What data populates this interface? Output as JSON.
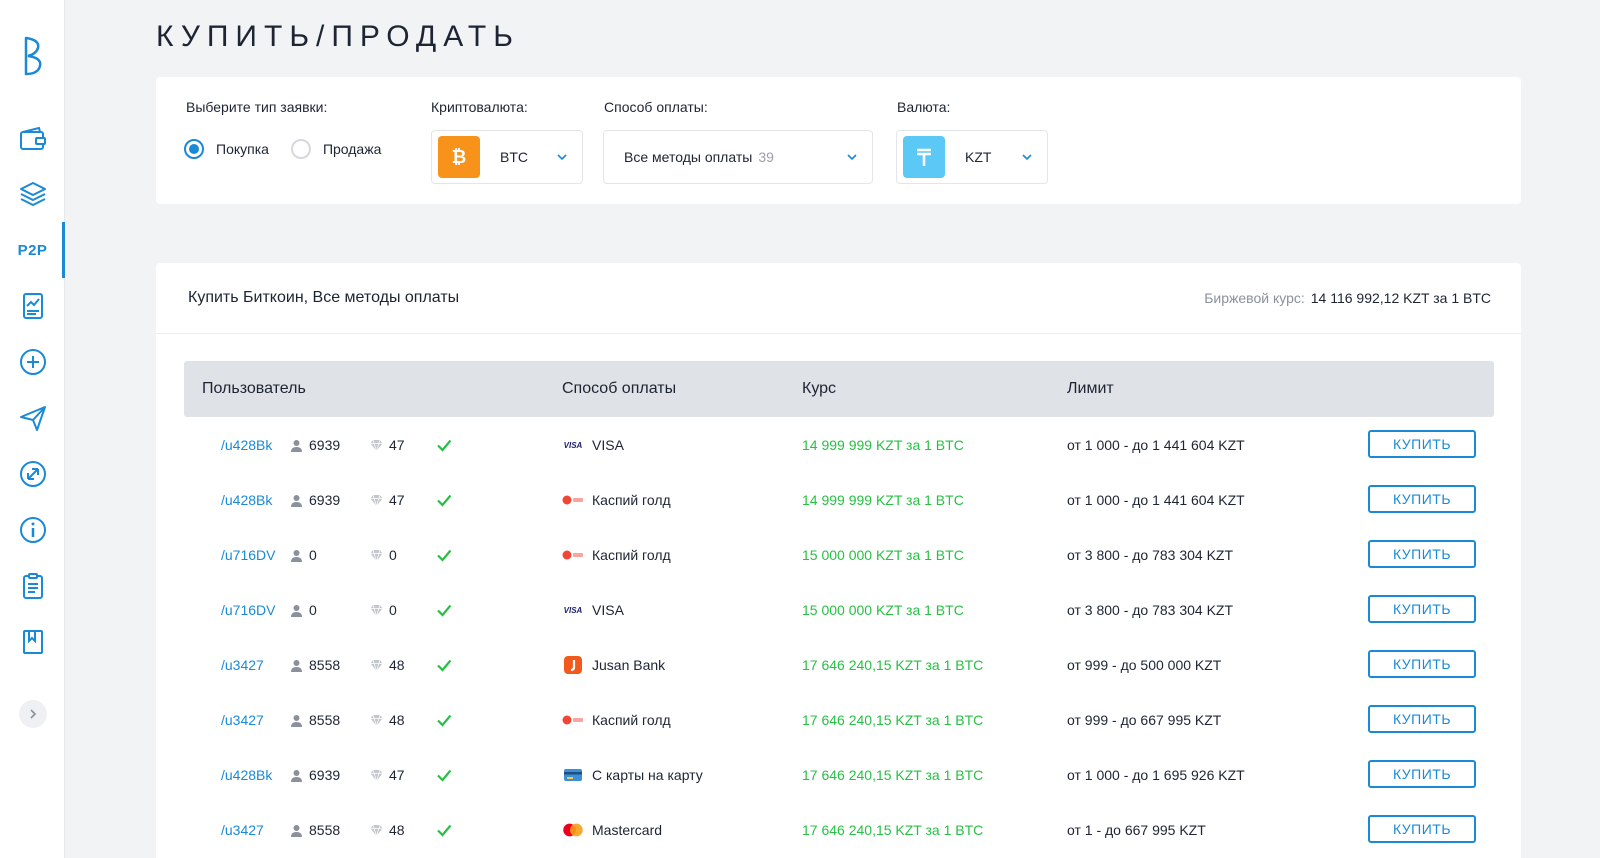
{
  "page": {
    "title": "КУПИТЬ/ПРОДАТЬ"
  },
  "sidebar": {
    "p2p_label": "P2P"
  },
  "filters": {
    "order_type_label": "Выберите тип заявки:",
    "buy_label": "Покупка",
    "sell_label": "Продажа",
    "selected_type": "buy",
    "crypto_label": "Криптовалюта:",
    "crypto_value": "BTC",
    "payment_label": "Способ оплаты:",
    "payment_value": "Все методы оплаты",
    "payment_count": "39",
    "currency_label": "Валюта:",
    "currency_value": "KZT"
  },
  "offers": {
    "title": "Купить Биткоин, Все методы оплаты",
    "rate_label": "Биржевой курс:",
    "rate_value": "14 116 992,12 KZT за 1 BTC",
    "columns": {
      "user": "Пользователь",
      "payment": "Способ оплаты",
      "rate": "Курс",
      "limit": "Лимит"
    },
    "buy_label": "КУПИТЬ",
    "rows": [
      {
        "user": "/u428Bk",
        "deals": "6939",
        "rating": "47",
        "method": "VISA",
        "method_icon": "visa-icon",
        "rate": "14 999 999 KZT за 1 BTC",
        "limit": "от 1 000 - до 1 441 604 KZT"
      },
      {
        "user": "/u428Bk",
        "deals": "6939",
        "rating": "47",
        "method": "Каспий голд",
        "method_icon": "kaspi-icon",
        "rate": "14 999 999 KZT за 1 BTC",
        "limit": "от 1 000 - до 1 441 604 KZT"
      },
      {
        "user": "/u716DV",
        "deals": "0",
        "rating": "0",
        "method": "Каспий голд",
        "method_icon": "kaspi-icon",
        "rate": "15 000 000 KZT за 1 BTC",
        "limit": "от 3 800 - до 783 304 KZT"
      },
      {
        "user": "/u716DV",
        "deals": "0",
        "rating": "0",
        "method": "VISA",
        "method_icon": "visa-icon",
        "rate": "15 000 000 KZT за 1 BTC",
        "limit": "от 3 800 - до 783 304 KZT"
      },
      {
        "user": "/u3427",
        "deals": "8558",
        "rating": "48",
        "method": "Jusan Bank",
        "method_icon": "jusan-icon",
        "rate": "17 646 240,15 KZT за 1 BTC",
        "limit": "от 999 - до 500 000 KZT"
      },
      {
        "user": "/u3427",
        "deals": "8558",
        "rating": "48",
        "method": "Каспий голд",
        "method_icon": "kaspi-icon",
        "rate": "17 646 240,15 KZT за 1 BTC",
        "limit": "от 999 - до 667 995 KZT"
      },
      {
        "user": "/u428Bk",
        "deals": "6939",
        "rating": "47",
        "method": "С карты на карту",
        "method_icon": "card-icon",
        "rate": "17 646 240,15 KZT за 1 BTC",
        "limit": "от 1 000 - до 1 695 926 KZT"
      },
      {
        "user": "/u3427",
        "deals": "8558",
        "rating": "48",
        "method": "Mastercard",
        "method_icon": "mastercard-icon",
        "rate": "17 646 240,15 KZT за 1 BTC",
        "limit": "от 1 - до 667 995 KZT"
      }
    ]
  },
  "colors": {
    "accent": "#1a8ad6",
    "rate_green": "#27c044",
    "btc_orange": "#f7931a",
    "kzt_blue": "#5bc8f5"
  }
}
